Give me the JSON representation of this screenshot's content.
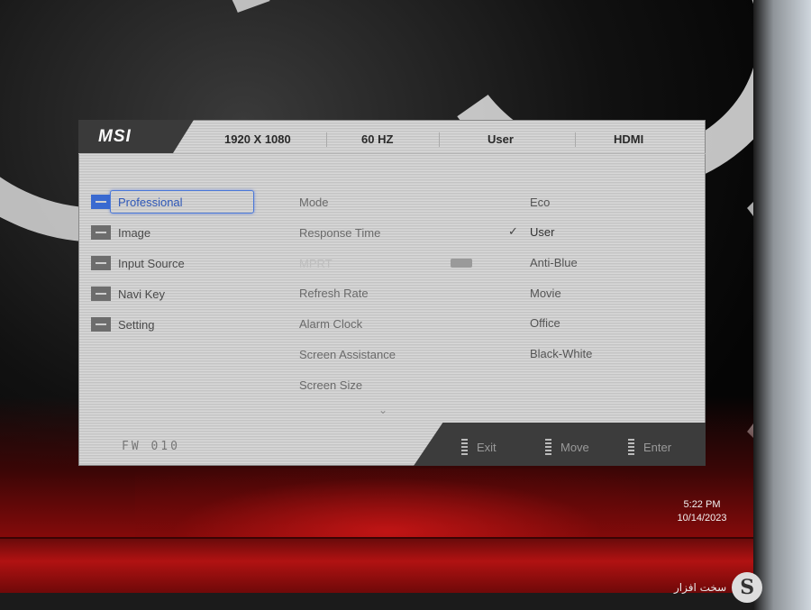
{
  "header": {
    "brand": "MSI",
    "resolution": "1920 X 1080",
    "refresh": "60 HZ",
    "mode": "User",
    "input": "HDMI"
  },
  "sidebar": {
    "items": [
      {
        "label": "Professional",
        "icon": "professional-icon",
        "active": true
      },
      {
        "label": "Image",
        "icon": "image-icon"
      },
      {
        "label": "Input Source",
        "icon": "input-source-icon"
      },
      {
        "label": "Navi Key",
        "icon": "navi-key-icon"
      },
      {
        "label": "Setting",
        "icon": "setting-icon"
      }
    ]
  },
  "menu": {
    "items": [
      {
        "label": "Mode"
      },
      {
        "label": "Response Time"
      },
      {
        "label": "MPRT",
        "disabled": true
      },
      {
        "label": "Refresh Rate"
      },
      {
        "label": "Alarm Clock"
      },
      {
        "label": "Screen Assistance"
      },
      {
        "label": "Screen Size"
      }
    ]
  },
  "options": {
    "items": [
      {
        "label": "Eco"
      },
      {
        "label": "User",
        "selected": true
      },
      {
        "label": "Anti-Blue"
      },
      {
        "label": "Movie"
      },
      {
        "label": "Office"
      },
      {
        "label": "Black-White"
      }
    ]
  },
  "footer": {
    "firmware": "FW 010",
    "exit": "Exit",
    "move": "Move",
    "enter": "Enter"
  },
  "taskbar": {
    "time": "5:22 PM",
    "date": "10/14/2023"
  },
  "watermark": {
    "text": "سخت افزار",
    "logo": "S"
  },
  "colors": {
    "accent": "#3a6ad0",
    "panel": "#d0d0d0",
    "brand_bg": "#3a3a3a",
    "bezel": "#b11212"
  }
}
